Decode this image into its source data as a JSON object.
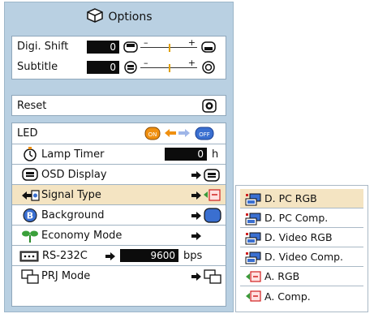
{
  "menu": {
    "title": "Options",
    "digi_shift": {
      "label": "Digi. Shift",
      "value": "0"
    },
    "subtitle": {
      "label": "Subtitle",
      "value": "0"
    },
    "reset": {
      "label": "Reset"
    },
    "led": {
      "label": "LED",
      "on_label": "ON",
      "off_label": "OFF"
    },
    "lamp_timer": {
      "label": "Lamp Timer",
      "value": "0",
      "unit": "h"
    },
    "osd_display": {
      "label": "OSD Display"
    },
    "signal_type": {
      "label": "Signal Type"
    },
    "background": {
      "label": "Background"
    },
    "economy_mode": {
      "label": "Economy Mode"
    },
    "rs232c": {
      "label": "RS-232C",
      "value": "9600",
      "unit": "bps"
    },
    "prj_mode": {
      "label": "PRJ Mode"
    }
  },
  "signal_options": [
    {
      "label": "D. PC RGB",
      "icon": "digital-signal-icon",
      "selected": true
    },
    {
      "label": "D. PC Comp.",
      "icon": "digital-signal-icon",
      "selected": false
    },
    {
      "label": "D. Video RGB",
      "icon": "digital-signal-icon",
      "selected": false
    },
    {
      "label": "D. Video Comp.",
      "icon": "digital-signal-icon",
      "selected": false
    },
    {
      "label": "A. RGB",
      "icon": "analog-signal-icon",
      "selected": false
    },
    {
      "label": "A. Comp.",
      "icon": "analog-signal-icon",
      "selected": false
    }
  ],
  "colors": {
    "panel_bg": "#b9d0e2",
    "highlight": "#f4e4c2",
    "accent_blue": "#3a6fd0",
    "led_orange": "#f09010"
  }
}
